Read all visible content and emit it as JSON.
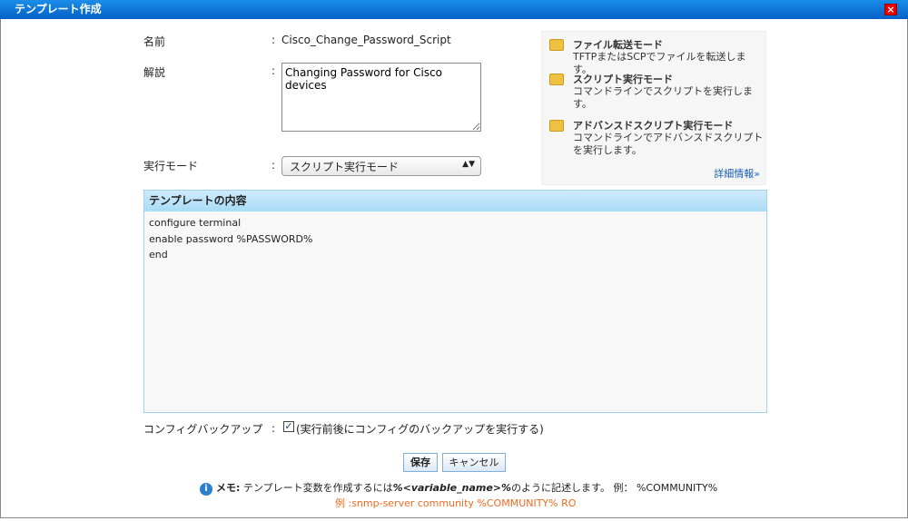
{
  "window": {
    "title": "テンプレート作成",
    "close": "×"
  },
  "form": {
    "name_label": "名前",
    "name_value": "Cisco_Change_Password_Script",
    "desc_label": "解説",
    "desc_value": "Changing Password for Cisco devices",
    "mode_label": "実行モード",
    "mode_value": "スクリプト実行モード",
    "colon": ":"
  },
  "info": {
    "modes": [
      {
        "title": "ファイル転送モード",
        "desc": "TFTPまたはSCPでファイルを転送します。",
        "icon": "folder-transfer-icon"
      },
      {
        "title": "スクリプト実行モード",
        "desc": "コマンドラインでスクリプトを実行します。",
        "icon": "folder-script-icon"
      },
      {
        "title": "アドバンスドスクリプト実行モード",
        "desc": "コマンドラインでアドバンスドスクリプトを実行します。",
        "icon": "folder-advanced-script-icon"
      }
    ],
    "more_link": "詳細情報»"
  },
  "template": {
    "header": "テンプレートの内容",
    "content": "configure terminal\nenable password %PASSWORD%\nend"
  },
  "backup": {
    "label": "コンフィグバックアップ",
    "checked": true,
    "check_label": "(実行前後にコンフィグのバックアップを実行する)"
  },
  "buttons": {
    "save": "保存",
    "cancel": "キャンセル"
  },
  "memo": {
    "prefix": "メモ:",
    "text1": "テンプレート変数を作成するには",
    "var": "%<variable_name>%",
    "text2": "のように記述します。 例： %COMMUNITY%",
    "example": "例 :snmp-server community %COMMUNITY% RO"
  }
}
